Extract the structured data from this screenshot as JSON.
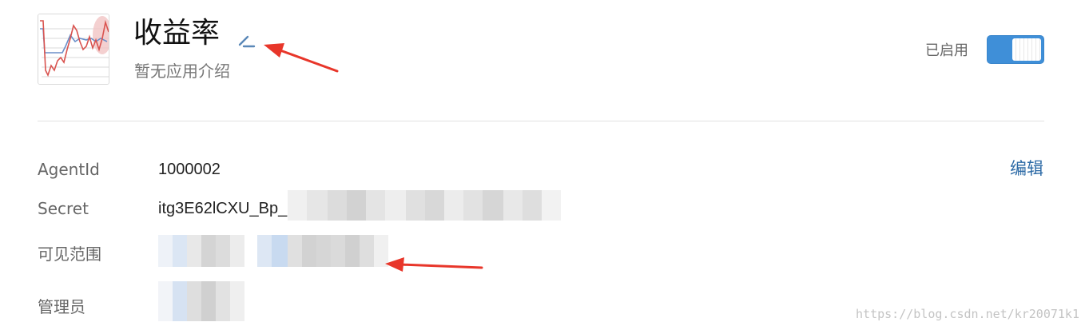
{
  "app": {
    "name": "收益率",
    "description": "暂无应用介绍",
    "status_label": "已启用",
    "enabled": true,
    "accent_color": "#3f8fd8"
  },
  "icons": {
    "app_icon": "line-chart-thumbnail-icon",
    "edit_name": "pencil-icon"
  },
  "details": {
    "agentid_label": "AgentId",
    "agentid_value": "1000002",
    "secret_label": "Secret",
    "secret_value": "itg3E62lCXU_Bp_",
    "visibility_label": "可见范围",
    "admin_label": "管理员",
    "edit_link": "编辑",
    "link_color": "#2c6aa6"
  },
  "watermark": "https://blog.csdn.net/kr20071k1"
}
